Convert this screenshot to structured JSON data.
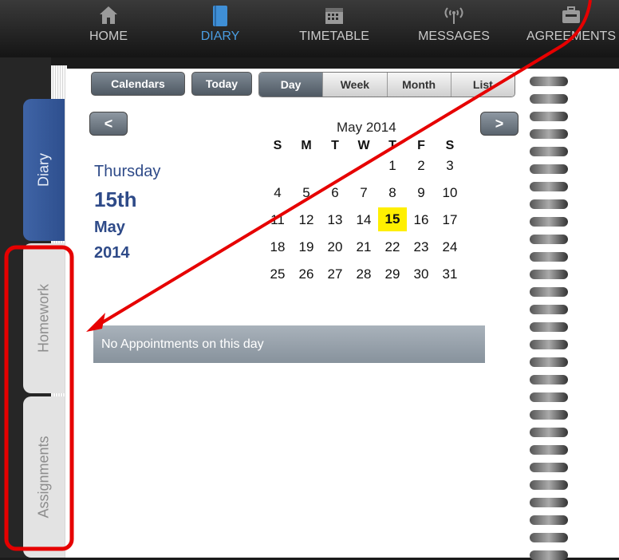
{
  "nav": {
    "items": [
      {
        "label": "HOME",
        "icon": "home-icon"
      },
      {
        "label": "DIARY",
        "icon": "book-icon",
        "active": true
      },
      {
        "label": "TIMETABLE",
        "icon": "calendar-icon"
      },
      {
        "label": "MESSAGES",
        "icon": "broadcast-icon"
      },
      {
        "label": "AGREEMENTS",
        "icon": "briefcase-icon"
      }
    ]
  },
  "tabs": {
    "diary": "Diary",
    "homework": "Homework",
    "assignments": "Assignments"
  },
  "toolbar": {
    "calendars": "Calendars",
    "today": "Today",
    "views": [
      "Day",
      "Week",
      "Month",
      "List"
    ],
    "prev": "<",
    "next": ">"
  },
  "selected": {
    "weekday": "Thursday",
    "day": "15th",
    "month": "May",
    "year": "2014"
  },
  "calendar": {
    "title": "May 2014",
    "weekdays": [
      "S",
      "M",
      "T",
      "W",
      "T",
      "F",
      "S"
    ],
    "weeks": [
      [
        "",
        "",
        "",
        "",
        "1",
        "2",
        "3"
      ],
      [
        "4",
        "5",
        "6",
        "7",
        "8",
        "9",
        "10"
      ],
      [
        "11",
        "12",
        "13",
        "14",
        "15",
        "16",
        "17"
      ],
      [
        "18",
        "19",
        "20",
        "21",
        "22",
        "23",
        "24"
      ],
      [
        "25",
        "26",
        "27",
        "28",
        "29",
        "30",
        "31"
      ]
    ],
    "today": "15"
  },
  "appointments": {
    "empty_text": "No Appointments on this day"
  },
  "colors": {
    "accent": "#4a9de2",
    "diary_tab": "#3f64a6",
    "today_highlight": "#ffef00",
    "annotation": "#e60000"
  }
}
